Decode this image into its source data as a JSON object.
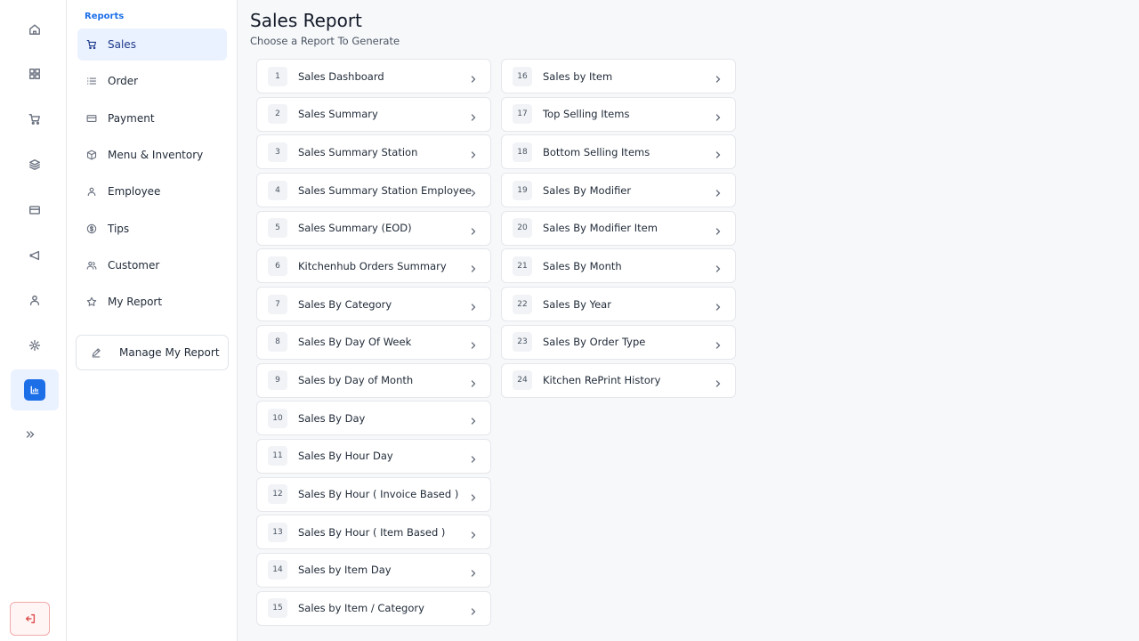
{
  "rail": {
    "icons": [
      "home-icon",
      "dashboard-icon",
      "cart-icon",
      "layers-icon",
      "card-icon",
      "megaphone-icon",
      "user-icon",
      "settings-icon",
      "reports-icon",
      "expand-icon",
      "logout-icon"
    ]
  },
  "sidebar": {
    "section_title": "Reports",
    "items": [
      {
        "label": "Sales",
        "icon": "cart-icon",
        "active": true
      },
      {
        "label": "Order",
        "icon": "list-icon"
      },
      {
        "label": "Payment",
        "icon": "card-icon"
      },
      {
        "label": "Menu & Inventory",
        "icon": "box-icon"
      },
      {
        "label": "Employee",
        "icon": "user-icon"
      },
      {
        "label": "Tips",
        "icon": "dollar-icon"
      },
      {
        "label": "Customer",
        "icon": "users-icon"
      },
      {
        "label": "My Report",
        "icon": "star-icon"
      }
    ],
    "manage_label": "Manage My Report"
  },
  "main": {
    "title": "Sales Report",
    "subtitle": "Choose a Report To Generate",
    "reports_left": [
      {
        "num": "1",
        "label": "Sales Dashboard"
      },
      {
        "num": "2",
        "label": "Sales Summary"
      },
      {
        "num": "3",
        "label": "Sales Summary Station"
      },
      {
        "num": "4",
        "label": "Sales Summary Station Employee"
      },
      {
        "num": "5",
        "label": " Sales Summary (EOD)"
      },
      {
        "num": "6",
        "label": "Kitchenhub Orders Summary"
      },
      {
        "num": "7",
        "label": "Sales By Category"
      },
      {
        "num": "8",
        "label": "Sales By Day Of Week"
      },
      {
        "num": "9",
        "label": "Sales by Day of Month"
      },
      {
        "num": "10",
        "label": "Sales By Day"
      },
      {
        "num": "11",
        "label": "Sales By Hour Day"
      },
      {
        "num": "12",
        "label": "Sales By Hour ( Invoice Based )"
      },
      {
        "num": "13",
        "label": "Sales By Hour ( Item Based )"
      },
      {
        "num": "14",
        "label": "Sales by Item Day"
      },
      {
        "num": "15",
        "label": "Sales by Item / Category"
      }
    ],
    "reports_right": [
      {
        "num": "16",
        "label": "Sales by Item"
      },
      {
        "num": "17",
        "label": "Top Selling Items"
      },
      {
        "num": "18",
        "label": "Bottom Selling Items"
      },
      {
        "num": "19",
        "label": "Sales By Modifier"
      },
      {
        "num": "20",
        "label": "Sales By Modifier Item"
      },
      {
        "num": "21",
        "label": "Sales By Month"
      },
      {
        "num": "22",
        "label": "Sales By Year"
      },
      {
        "num": "23",
        "label": "Sales By Order Type"
      },
      {
        "num": "24",
        "label": "Kitchen RePrint History"
      }
    ]
  },
  "colors": {
    "accent": "#1d6fe8",
    "active_bg": "#eaf1ff",
    "logout": "#e05252"
  }
}
